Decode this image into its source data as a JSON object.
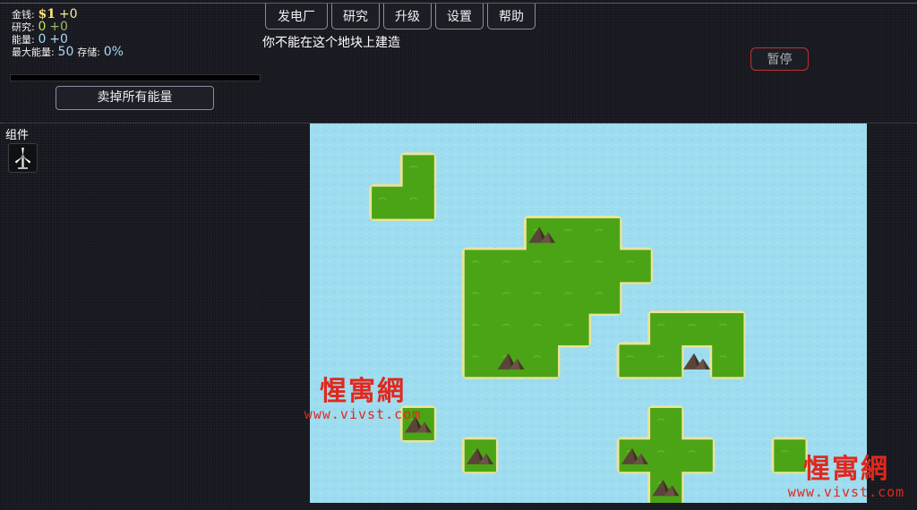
{
  "stats": {
    "money_label": "金钱:",
    "money_value": "$1",
    "money_income": "+0",
    "research_label": "研究:",
    "research_value": "0",
    "research_income": "+0",
    "energy_label": "能量:",
    "energy_value": "0",
    "energy_income": "+0",
    "max_energy_label": "最大能量:",
    "max_energy_value": "50",
    "storage_label": "存储:",
    "storage_value": "0%",
    "storage_fraction": 0
  },
  "sell_button_label": "卖掉所有能量",
  "tabs": [
    {
      "label": "发电厂"
    },
    {
      "label": "研究"
    },
    {
      "label": "升级"
    },
    {
      "label": "设置"
    },
    {
      "label": "帮助"
    }
  ],
  "message": "你不能在这个地块上建造",
  "pause_button_label": "暂停",
  "components": {
    "title": "组件",
    "items": [
      {
        "icon": "wind-turbine-icon"
      }
    ]
  },
  "map": {
    "cols": 18,
    "rows": 12,
    "islands": [
      {
        "name": "north-west",
        "cells": [
          [
            3,
            1
          ],
          [
            2,
            2
          ],
          [
            3,
            2
          ]
        ]
      },
      {
        "name": "central",
        "cells": [
          [
            7,
            3
          ],
          [
            8,
            3
          ],
          [
            9,
            3
          ],
          [
            5,
            4
          ],
          [
            6,
            4
          ],
          [
            7,
            4
          ],
          [
            8,
            4
          ],
          [
            9,
            4
          ],
          [
            10,
            4
          ],
          [
            5,
            5
          ],
          [
            6,
            5
          ],
          [
            7,
            5
          ],
          [
            8,
            5
          ],
          [
            9,
            5
          ],
          [
            5,
            6
          ],
          [
            6,
            6
          ],
          [
            7,
            6
          ],
          [
            8,
            6
          ],
          [
            5,
            7
          ],
          [
            6,
            7
          ],
          [
            7,
            7
          ]
        ]
      },
      {
        "name": "east",
        "cells": [
          [
            11,
            6
          ],
          [
            12,
            6
          ],
          [
            13,
            6
          ],
          [
            10,
            7
          ],
          [
            11,
            7
          ],
          [
            13,
            7
          ]
        ]
      },
      {
        "name": "south-west-islet",
        "cells": [
          [
            3,
            9
          ]
        ]
      },
      {
        "name": "south-islet",
        "cells": [
          [
            5,
            10
          ]
        ]
      },
      {
        "name": "south-east-cross",
        "cells": [
          [
            11,
            9
          ],
          [
            10,
            10
          ],
          [
            11,
            10
          ],
          [
            12,
            10
          ],
          [
            11,
            11
          ]
        ]
      },
      {
        "name": "far-east-islet",
        "cells": [
          [
            15,
            10
          ]
        ]
      }
    ],
    "mountains": [
      [
        7,
        3
      ],
      [
        6,
        7
      ],
      [
        12,
        7
      ],
      [
        3,
        9
      ],
      [
        5,
        10
      ],
      [
        10,
        10
      ],
      [
        11,
        11
      ]
    ],
    "colors": {
      "water": "#9edcef",
      "land": "#4ba416",
      "shore": "#e8e49a",
      "mountain": "#5a4538"
    }
  },
  "watermark": {
    "brand": "惺寓網",
    "url": "www.vivst.com"
  }
}
